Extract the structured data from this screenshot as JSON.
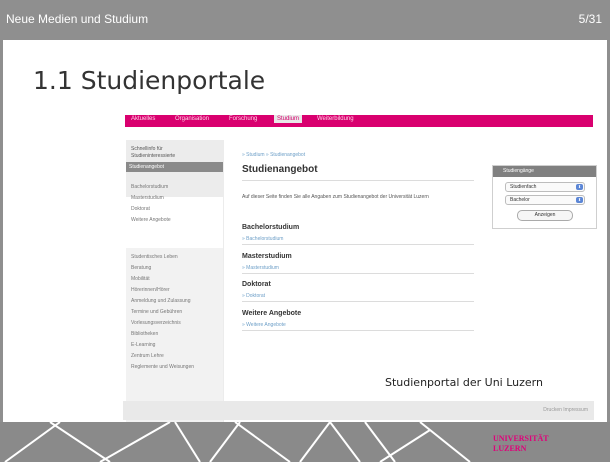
{
  "header": {
    "title": "Neue Medien und Studium",
    "page": "5/31"
  },
  "slide_title": "1.1 Studienportale",
  "site": {
    "nav": [
      "Aktuelles",
      "Organisation",
      "Forschung",
      "Studium",
      "Weiterbildung"
    ],
    "nav_active": "Studium",
    "sidebar": {
      "group1": [
        "Schnellinfo für",
        "Studieninteressierte",
        "Studienangebot"
      ],
      "group2": [
        "Bachelorstudium",
        "Masterstudium",
        "Doktorat",
        "Weitere Angebote"
      ],
      "group3": [
        "Studentisches Leben",
        "Beratung",
        "Mobilität",
        "Hörerinnen/Hörer",
        "Anmeldung und Zulassung",
        "Termine und Gebühren",
        "Vorlesungsverzeichnis",
        "Bibliotheken",
        "E-Learning",
        "Zentrum Lehre",
        "Reglemente und Weisungen"
      ]
    },
    "breadcrumb": "» Studium  » Studienangebot",
    "heading": "Studienangebot",
    "intro": "Auf dieser Seite finden Sie alle Angaben zum Studienangebot der Universität Luzern",
    "sections": [
      {
        "title": "Bachelorstudium",
        "link": "» Bachelorstudium"
      },
      {
        "title": "Masterstudium",
        "link": "» Masterstudium"
      },
      {
        "title": "Doktorat",
        "link": "» Doktorat"
      },
      {
        "title": "Weitere Angebote",
        "link": "» Weitere Angebote"
      }
    ],
    "widget": {
      "title": "Studiengänge",
      "select1": "Studienfach",
      "select2": "Bachelor",
      "button": "Anzeigen"
    },
    "footer": "Drucken  Impressum"
  },
  "caption": "Studienportal der Uni Luzern",
  "logo": {
    "line1": "UNIVERSITÄT",
    "line2": "LUZERN"
  },
  "colors": {
    "accent": "#d9006f",
    "frame": "#8f8f8f"
  }
}
